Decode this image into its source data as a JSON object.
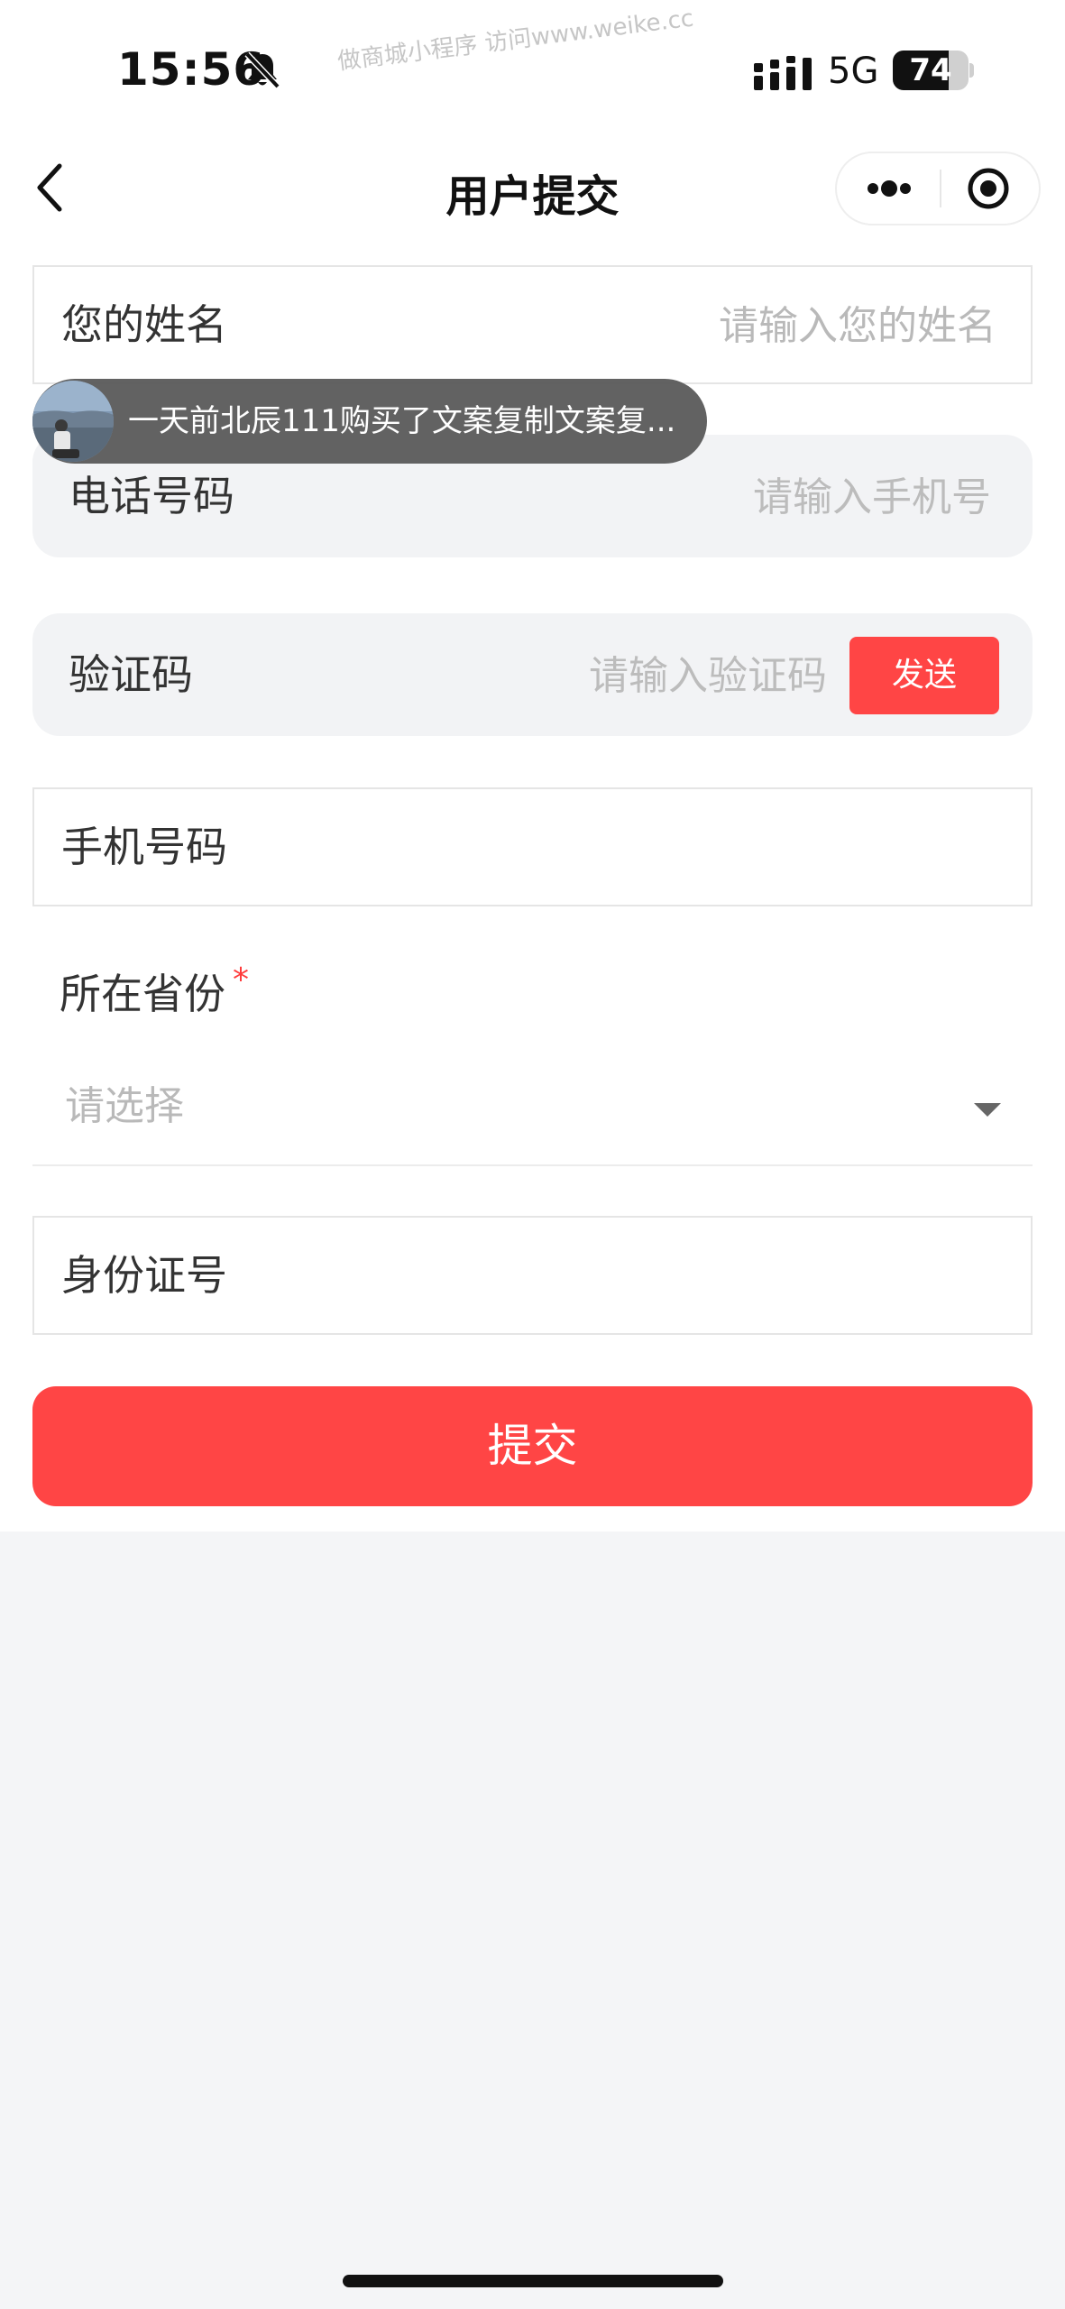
{
  "status_bar": {
    "time": "15:56",
    "network": "5G",
    "battery": "74",
    "battery_level": 0.74,
    "watermark": "做商城小程序 访问www.weike.cc"
  },
  "nav": {
    "title": "用户提交"
  },
  "form": {
    "name": {
      "label": "您的姓名",
      "placeholder": "请输入您的姓名",
      "value": ""
    },
    "phone": {
      "label": "电话号码",
      "placeholder": "请输入手机号",
      "value": ""
    },
    "code": {
      "label": "验证码",
      "placeholder": "请输入验证码",
      "value": "",
      "send_label": "发送"
    },
    "mobile": {
      "label": "手机号码",
      "value": ""
    },
    "province": {
      "label": "所在省份",
      "required_mark": "*",
      "placeholder": "请选择"
    },
    "id_number": {
      "label": "身份证号",
      "value": ""
    },
    "submit_label": "提交"
  },
  "toast": {
    "text": "一天前北辰111购买了文案复制文案复..."
  },
  "colors": {
    "accent": "#ff4545",
    "pill_bg": "#f2f3f5",
    "page_bg": "#f4f5f7"
  },
  "icons": {
    "back": "back-arrow-icon",
    "more": "more-dots-icon",
    "close": "target-circle-icon",
    "bell": "bell-muted-icon",
    "signal": "signal-bars-icon",
    "caret": "caret-down-icon"
  }
}
